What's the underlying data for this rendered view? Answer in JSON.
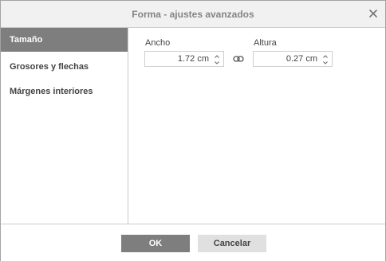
{
  "dialog": {
    "title": "Forma - ajustes avanzados"
  },
  "sidebar": {
    "items": [
      {
        "label": "Tamaño",
        "active": true
      },
      {
        "label": "Grosores y flechas",
        "active": false
      },
      {
        "label": "Márgenes interiores",
        "active": false
      }
    ]
  },
  "size": {
    "width": {
      "label": "Ancho",
      "value": "1.72 cm"
    },
    "height": {
      "label": "Altura",
      "value": "0.27 cm"
    },
    "constrain_icon": "link-icon"
  },
  "footer": {
    "ok_label": "OK",
    "cancel_label": "Cancelar"
  },
  "colors": {
    "active_bg": "#7e7e7e",
    "panel_bg": "#f1f1f1",
    "border": "#cbcbcb",
    "text": "#444444"
  }
}
